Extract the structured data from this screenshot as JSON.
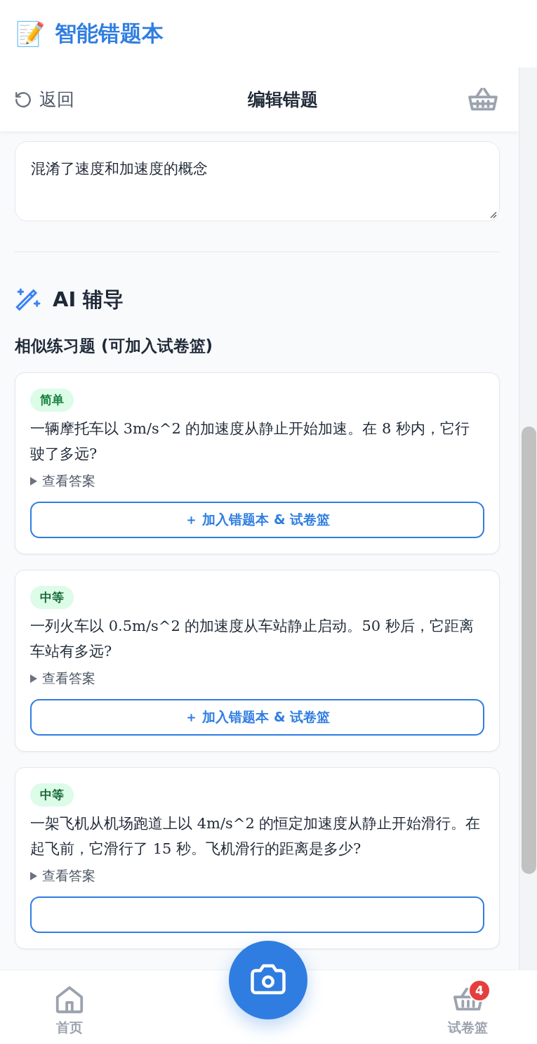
{
  "app": {
    "icon": "📝",
    "title": "智能错题本"
  },
  "nav": {
    "back": "返回",
    "title": "编辑错题"
  },
  "note_field": {
    "value": "混淆了速度和加速度的概念"
  },
  "ai_section": {
    "title": "AI 辅导",
    "subtitle": "相似练习题 (可加入试卷篮)"
  },
  "exercises": [
    {
      "level": "简单",
      "kind": "easy",
      "question": "一辆摩托车以 3m/s^2 的加速度从静止开始加速。在 8 秒内，它行驶了多远?",
      "answer_toggle": "查看答案",
      "action": "＋ 加入错题本 & 试卷篮"
    },
    {
      "level": "中等",
      "kind": "medium",
      "question": "一列火车以 0.5m/s^2 的加速度从车站静止启动。50 秒后，它距离车站有多远?",
      "answer_toggle": "查看答案",
      "action": "＋ 加入错题本 & 试卷篮"
    },
    {
      "level": "中等",
      "kind": "medium",
      "question": "一架飞机从机场跑道上以 4m/s^2 的恒定加速度从静止开始滑行。在起飞前，它滑行了 15 秒。飞机滑行的距离是多少?",
      "answer_toggle": "查看答案"
    }
  ],
  "bottom_nav": {
    "home": "首页",
    "basket": "试卷篮",
    "basket_count": "4"
  }
}
